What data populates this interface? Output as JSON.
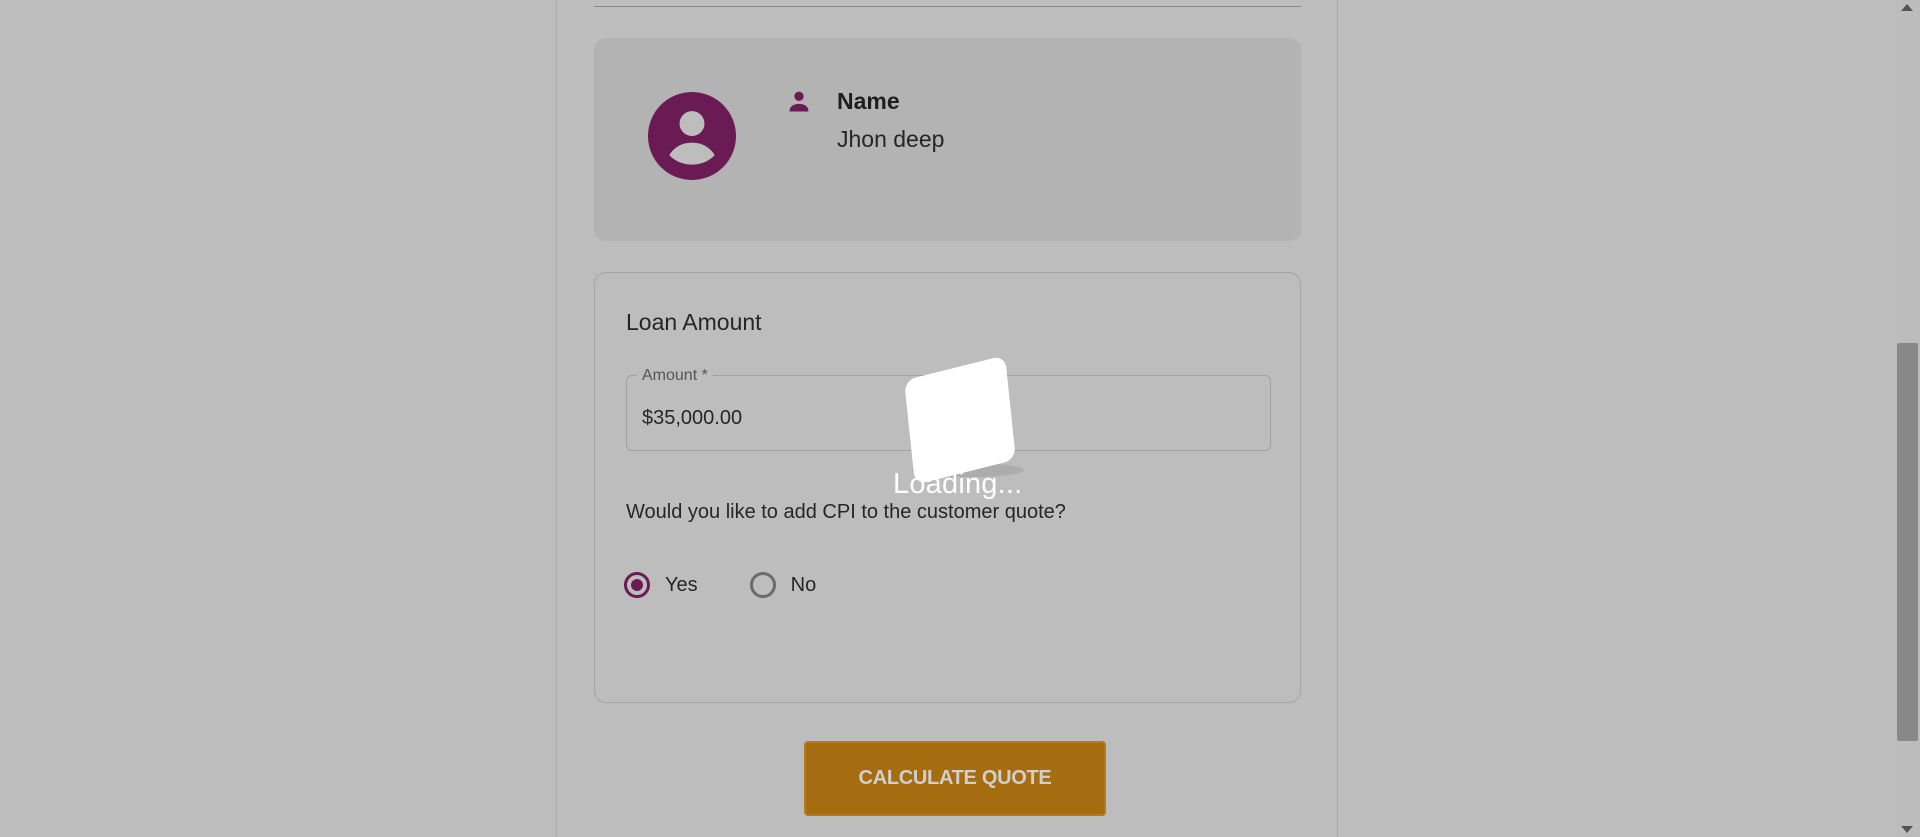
{
  "profile": {
    "name_label": "Name",
    "name_value": "Jhon deep",
    "avatar_icon": "account-circle-icon",
    "name_icon": "person-icon"
  },
  "loan": {
    "title": "Loan Amount",
    "amount_label": "Amount *",
    "amount_value": "$35,000.00",
    "cpi_question": "Would you like to add CPI to the customer quote?",
    "options": [
      {
        "label": "Yes",
        "selected": true
      },
      {
        "label": "No",
        "selected": false
      }
    ]
  },
  "actions": {
    "calculate_label": "CALCULATE QUOTE"
  },
  "loader": {
    "text": "Loading..."
  },
  "colors": {
    "brand": "#6b1b53",
    "button": "#a66c10",
    "overlay_bg": "#bdbdbd"
  }
}
